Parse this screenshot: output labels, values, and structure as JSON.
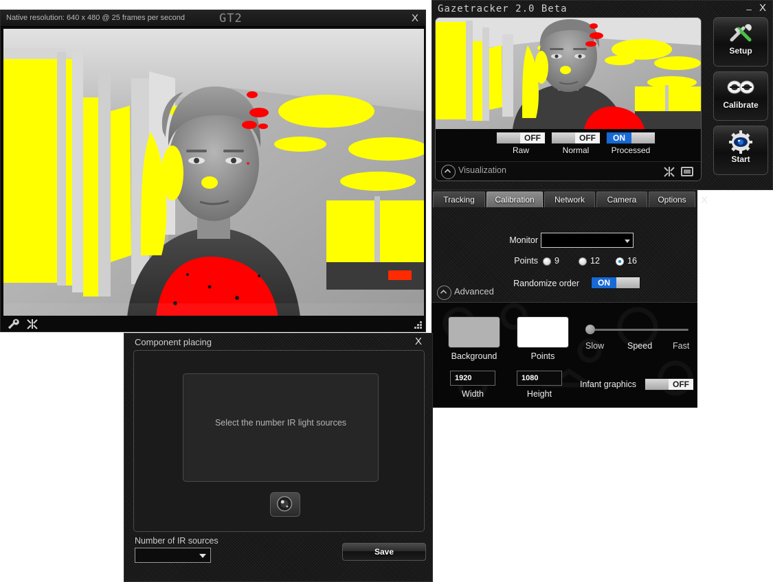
{
  "video_window": {
    "resolution_label": "Native resolution: 640 x 480 @ 25 frames per second",
    "logo": "GT2",
    "close_label": "X",
    "toolbar": {
      "settings_icon": "wrench-icon",
      "markers_icon": "crosshair-icon"
    },
    "resize_grip_icon": "resize-grip-icon"
  },
  "main_window": {
    "title": "Gazetracker 2.0 Beta",
    "minimize_label": "–",
    "close_label": "X",
    "preview": {
      "toggles": [
        {
          "label": "Raw",
          "state": "OFF"
        },
        {
          "label": "Normal",
          "state": "OFF"
        },
        {
          "label": "Processed",
          "state": "ON"
        }
      ],
      "visualization_label": "Visualization",
      "collapse_icon": "chevron-up-icon",
      "crosshair_icon": "crosshair-icon",
      "frame_icon": "frame-icon"
    },
    "actions": [
      {
        "label": "Setup",
        "icon": "tools-icon"
      },
      {
        "label": "Calibrate",
        "icon": "eyes-icon"
      },
      {
        "label": "Start",
        "icon": "gear-eye-icon"
      }
    ]
  },
  "tab_panel": {
    "tabs": [
      {
        "label": "Tracking",
        "active": false
      },
      {
        "label": "Calibration",
        "active": true
      },
      {
        "label": "Network",
        "active": false
      },
      {
        "label": "Camera",
        "active": false
      },
      {
        "label": "Options",
        "active": false
      }
    ],
    "close_label": "X",
    "calibration": {
      "monitor_label": "Monitor",
      "monitor_value": "",
      "points_label": "Points",
      "points_options": [
        "9",
        "12",
        "16"
      ],
      "points_selected": "16",
      "randomize_label": "Randomize order",
      "randomize_state": "ON"
    },
    "advanced": {
      "label": "Advanced",
      "collapse_icon": "chevron-up-icon",
      "background_label": "Background",
      "background_color": "#b2b2b2",
      "points_label": "Points",
      "points_color": "#ffffff",
      "width_label": "Width",
      "width_value": "1920",
      "height_label": "Height",
      "height_value": "1080",
      "speed_slow_label": "Slow",
      "speed_label": "Speed",
      "speed_fast_label": "Fast",
      "speed_value": 0,
      "infant_label": "Infant graphics",
      "infant_state": "OFF"
    }
  },
  "component_dialog": {
    "title": "Component placing",
    "close_label": "X",
    "placeholder_text": "Select the number IR light sources",
    "camera_icon": "camera-lens-icon",
    "ir_count_label": "Number of IR sources",
    "ir_count_value": "",
    "save_label": "Save"
  }
}
